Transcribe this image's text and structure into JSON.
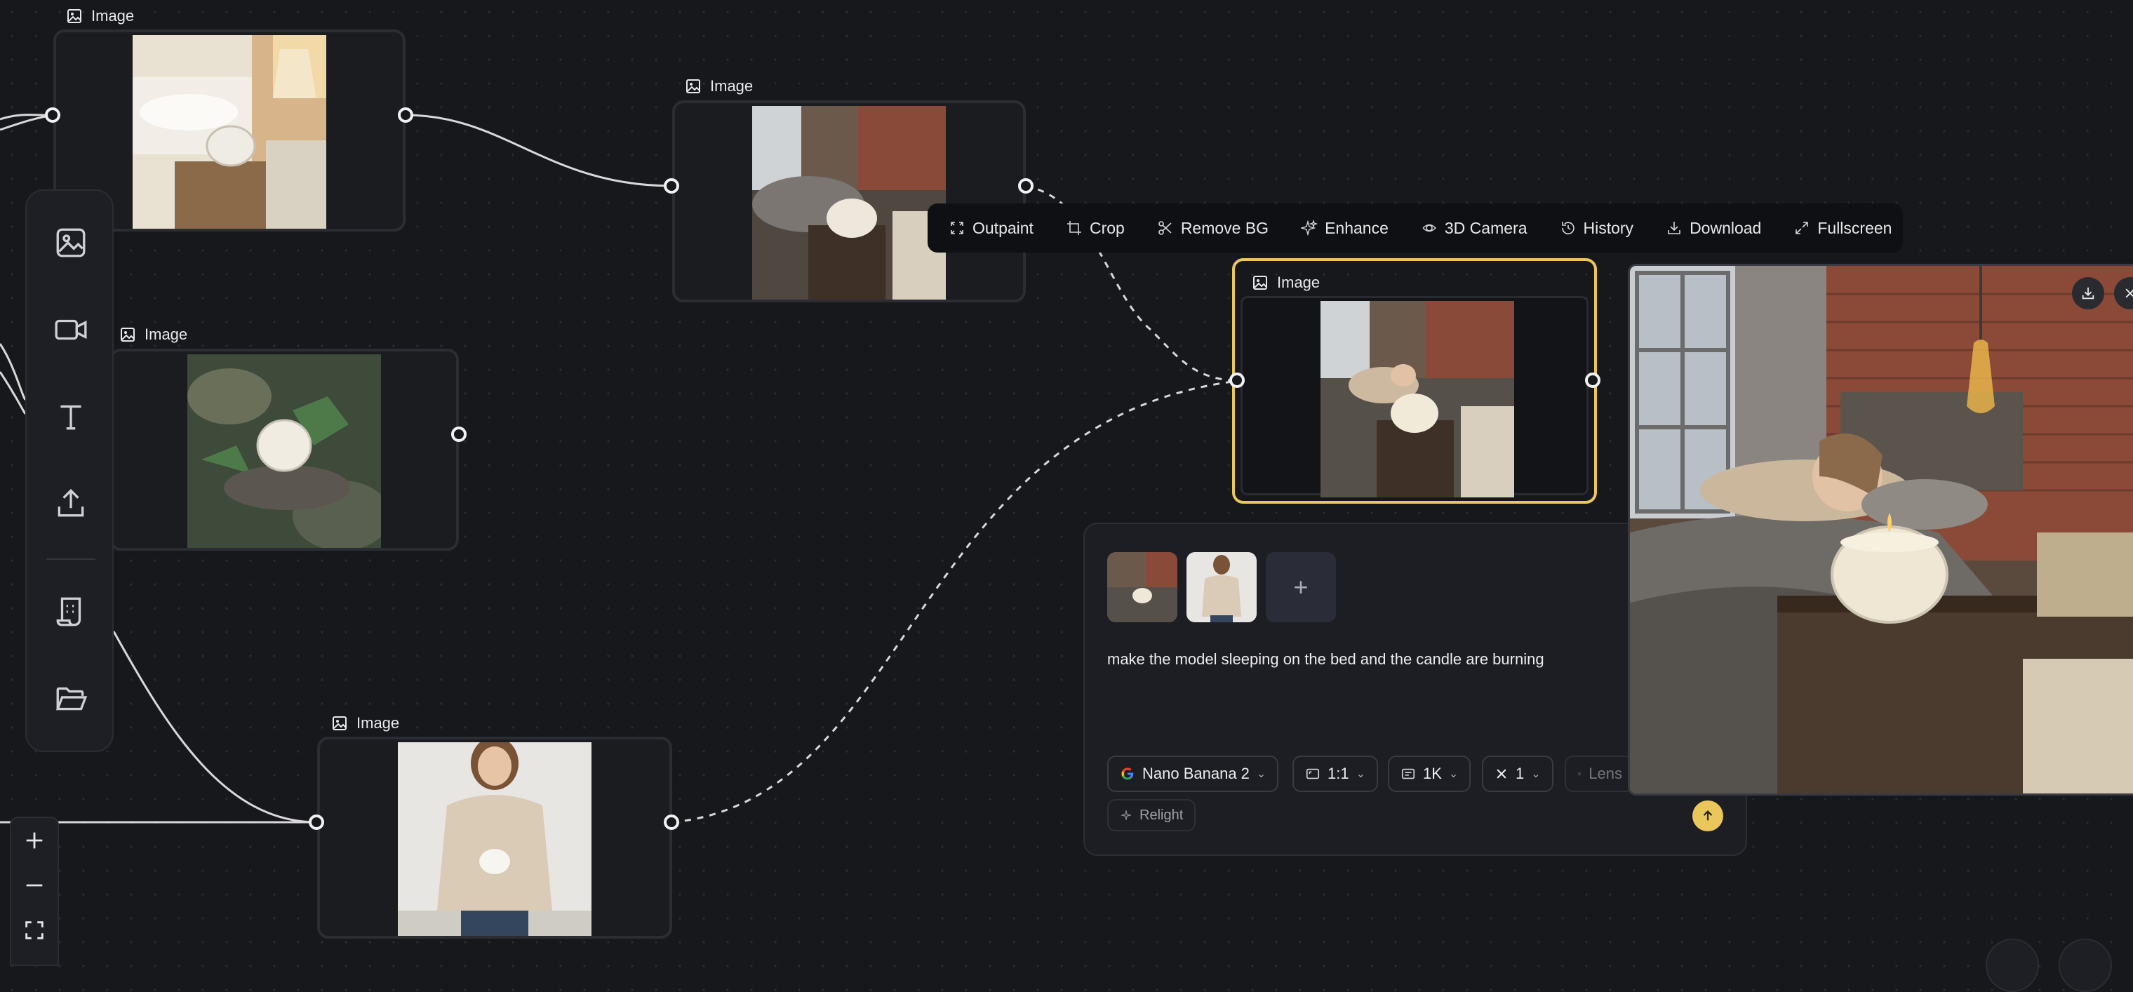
{
  "nodes": {
    "node1": {
      "title": "Image",
      "image": "bedroom-nightstand-candle"
    },
    "node2": {
      "title": "Image",
      "image": "loft-bedroom-candle"
    },
    "node3": {
      "title": "Image",
      "image": "stream-stone-candle"
    },
    "node4": {
      "title": "Image",
      "image": "model-holding-candle"
    },
    "node5": {
      "title": "Image",
      "image": "sleeping-model-candle"
    }
  },
  "left_toolbar": {
    "items": [
      "image-icon",
      "video-icon",
      "text-icon",
      "upload-icon",
      "script-icon",
      "folder-icon"
    ]
  },
  "zoom_controls": {
    "items": [
      "zoom-in-icon",
      "zoom-out-icon",
      "fit-screen-icon"
    ]
  },
  "toolbar": {
    "outpaint": "Outpaint",
    "crop": "Crop",
    "remove_bg": "Remove BG",
    "enhance": "Enhance",
    "camera_3d": "3D Camera",
    "history": "History",
    "download": "Download",
    "fullscreen": "Fullscreen"
  },
  "prompt_panel": {
    "prompt": "make the model sleeping on the bed and the candle are burning",
    "model": "Nano Banana 2",
    "aspect": "1:1",
    "resolution": "1K",
    "count": "1",
    "lens": "Lens",
    "relight": "Relight",
    "add_label": "+"
  },
  "colors": {
    "accent": "#e9c75a",
    "background": "#17181c",
    "panel": "#1d1e23"
  }
}
